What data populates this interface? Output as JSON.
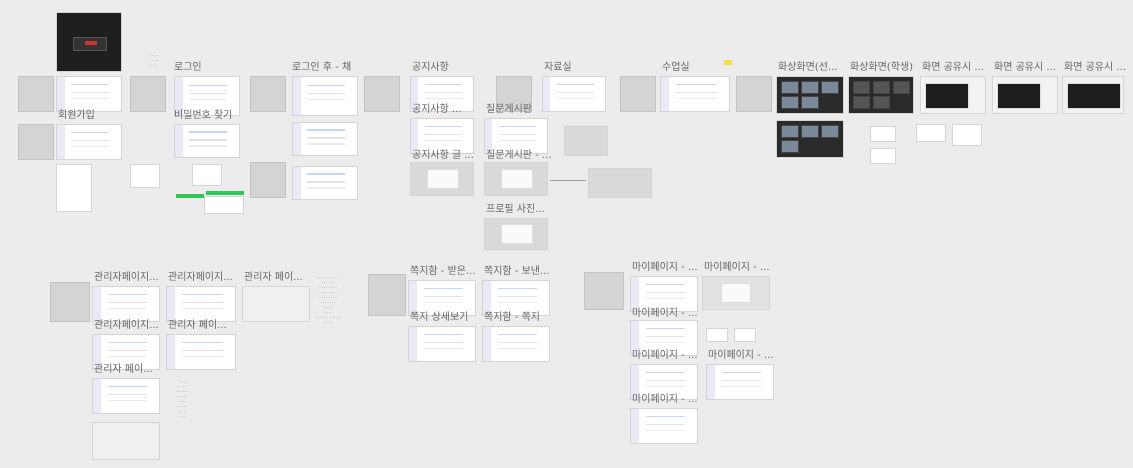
{
  "board": {
    "background": "#ececec",
    "frame_titles": {
      "signup": "회원가입",
      "login": "로그인",
      "find_password": "비밀번호 찾기",
      "login_after": "로그인 후 - 채",
      "notice": "공지사항",
      "notice_detail": "공지사항 ...",
      "notice_write": "공지사항 글 ...",
      "qna": "질문게시판",
      "qna_detail": "질문게시판 - ...",
      "profile_photo": "프로필 사진...",
      "archive": "자료실",
      "classroom": "수업실",
      "video_teacher": "화상화면(선...",
      "video_student": "화상화면(학생)",
      "screen_share_1": "화면 공유시 ...",
      "screen_share_2": "화면 공유시 ...",
      "screen_share_3": "화면 공유시 ...",
      "admin_1": "관리자페이지...",
      "admin_2": "관리자페이지...",
      "admin_3": "관리자 페이...",
      "admin_4": "관리자페이지...",
      "admin_5": "관리자 페이...",
      "admin_6": "관리자 페이...",
      "note_recv": "쪽지함 - 받은...",
      "note_sent": "쪽지함 - 보낸...",
      "note_write": "쪽지 상세보기",
      "note_view": "쪽지함 - 쪽지",
      "mypage_1": "마이페이지 - ...",
      "mypage_2": "마이페이지 - ...",
      "mypage_3": "마이페이지 - ...",
      "mypage_4": "마이페이지 - ...",
      "mypage_5": "마이페이지 - ...",
      "mypage_6": "마이페이지 - ..."
    },
    "colors": {
      "sidebar": "#ece9f6",
      "accent_blue": "#c7d6f2",
      "dark_frame": "#1e1e1e",
      "green_button": "#32c65a",
      "yellow_sticky": "#f7e14b"
    }
  }
}
